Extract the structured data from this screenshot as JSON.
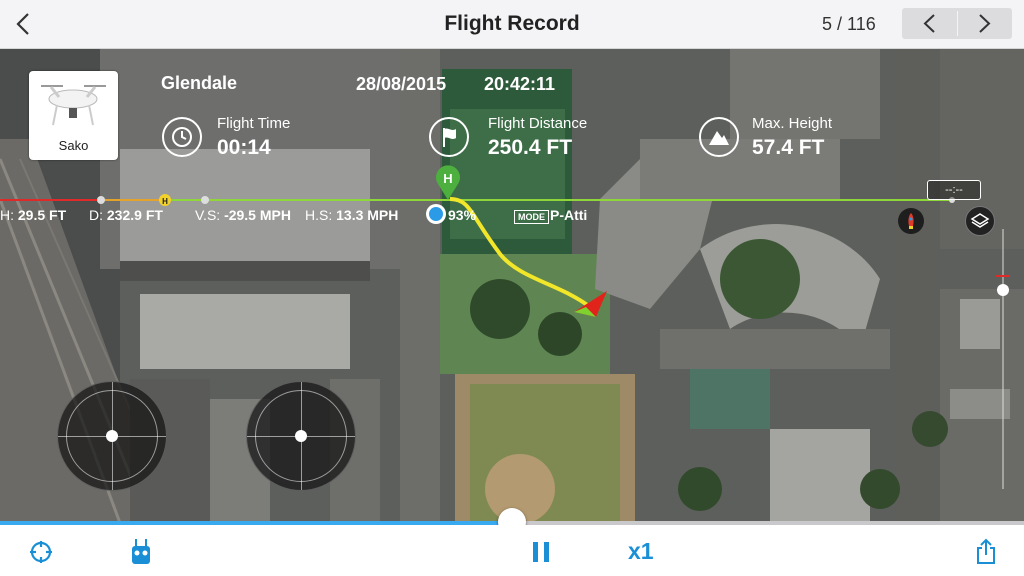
{
  "header": {
    "title": "Flight Record",
    "pager": "5 / 116"
  },
  "aircraft": {
    "name": "Sako"
  },
  "flight": {
    "location": "Glendale",
    "date": "28/08/2015",
    "time": "20:42:11"
  },
  "stats": {
    "flight_time_label": "Flight Time",
    "flight_time_value": "00:14",
    "distance_label": "Flight Distance",
    "distance_value": "250.4 FT",
    "height_label": "Max. Height",
    "height_value": "57.4 FT"
  },
  "telemetry": {
    "h_label": "H:",
    "h_value": "29.5 FT",
    "d_label": "D:",
    "d_value": "232.9 FT",
    "vs_label": "V.S:",
    "vs_value": "-29.5 MPH",
    "hs_label": "H.S:",
    "hs_value": "13.3 MPH",
    "battery_value": "93%",
    "mode_badge": "MODE",
    "mode_value": "P-Atti"
  },
  "markers": {
    "home": "H",
    "distance_readout": "--:--"
  },
  "playback": {
    "progress_fraction": 0.5,
    "speed_label": "x1"
  },
  "colors": {
    "accent": "#1a8fd6",
    "flight_path": "#f2e62a",
    "home_marker": "#4caf3e",
    "aircraft_arrow": "#e0241c"
  }
}
